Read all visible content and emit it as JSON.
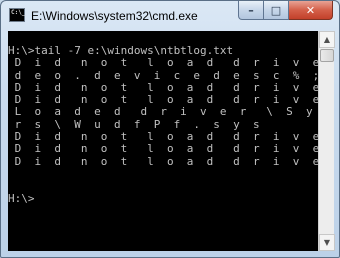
{
  "window": {
    "title": "E:\\Windows\\system32\\cmd.exe",
    "app_icon_text": "C:\\_"
  },
  "controls": {
    "minimize": "–",
    "maximize": "□",
    "close": "✕"
  },
  "console": {
    "lines": [
      "H:\\>tail -7 e:\\windows\\ntbtlog.txt",
      " D  i  d   n  o  t   l  o  a  d   d  r  i  v  e  r   @",
      " d  e  o  .  d  e  v  i  c  e  d  e  s  c  %  ;  U  S  B   V",
      " D  i  d   n  o  t   l  o  a  d   d  r  i  v  e  r   A",
      " D  i  d   n  o  t   l  o  a  d   d  r  i  v  e  r   A",
      " L  o  a  d  e  d   d  r  i  v  e  r   \\  S  y  s  t  e  m",
      " r  s  \\  W  u  d  f  P  f  .  s  y  s",
      " D  i  d   n  o  t   l  o  a  d   d  r  i  v  e  r   A",
      " D  i  d   n  o  t   l  o  a  d   d  r  i  v  e  r   A",
      " D  i  d   n  o  t   l  o  a  d   d  r  i  v  e  r   A",
      "",
      "",
      "H:\\>"
    ]
  },
  "scrollbar": {
    "up_arrow": "▲",
    "down_arrow": "▼",
    "position_fraction": 0.0
  },
  "colors": {
    "console_bg": "#000000",
    "console_fg": "#c0c0c0",
    "close_button": "#c7503a"
  }
}
